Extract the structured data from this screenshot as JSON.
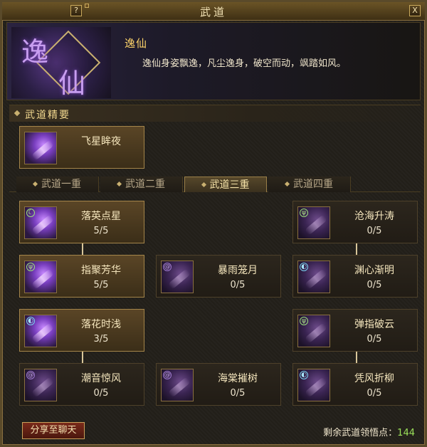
{
  "window": {
    "title": "武道",
    "help_label": "?",
    "close_label": "X"
  },
  "header": {
    "emblem_chars": [
      "逸",
      "仙"
    ],
    "name": "逸仙",
    "description": "逸仙身姿飘逸，凡尘逸身，破空而动，飒踏如风。"
  },
  "essence": {
    "title": "武道精要",
    "skill": {
      "name": "飞星眸夜",
      "icon": "purple-blade-icon"
    }
  },
  "tabs": [
    "武道一重",
    "武道二重",
    "武道三重",
    "武道四重"
  ],
  "active_tab": "武道三重",
  "skills": [
    {
      "name": "落英点星",
      "level": "5/5",
      "state": "lit"
    },
    {
      "name": "沧海升涛",
      "level": "0/5",
      "state": "dim"
    },
    {
      "name": "指聚芳华",
      "level": "5/5",
      "state": "lit"
    },
    {
      "name": "暴雨笼月",
      "level": "0/5",
      "state": "dim"
    },
    {
      "name": "渊心渐明",
      "level": "0/5",
      "state": "dim"
    },
    {
      "name": "落花时浅",
      "level": "3/5",
      "state": "lit"
    },
    {
      "name": "弹指破云",
      "level": "0/5",
      "state": "dim"
    },
    {
      "name": "潮音惊风",
      "level": "0/5",
      "state": "dim"
    },
    {
      "name": "海棠摧树",
      "level": "0/5",
      "state": "dim"
    },
    {
      "name": "凭风折柳",
      "level": "0/5",
      "state": "dim"
    }
  ],
  "footer": {
    "share_label": "分享至聊天",
    "points_label": "剩余武道领悟点：",
    "points_value": "144"
  }
}
